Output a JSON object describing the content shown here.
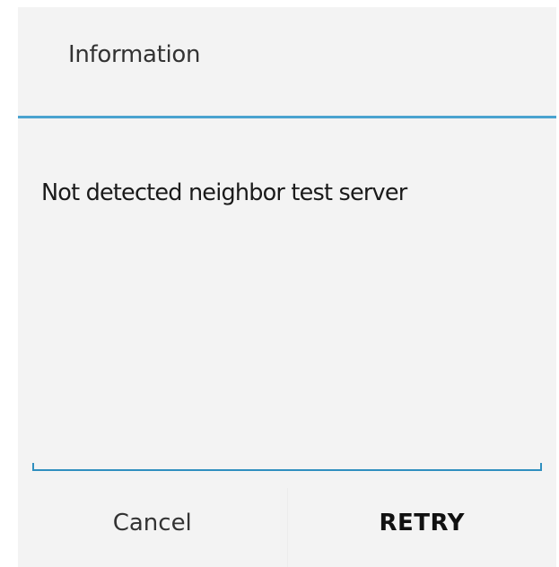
{
  "dialog": {
    "title": "Information",
    "message": "Not detected neighbor test server",
    "buttons": {
      "cancel_label": "Cancel",
      "retry_label": "RETRY"
    }
  },
  "colors": {
    "accent": "#4aa3cf",
    "background": "#f3f3f3",
    "text": "#333333"
  }
}
